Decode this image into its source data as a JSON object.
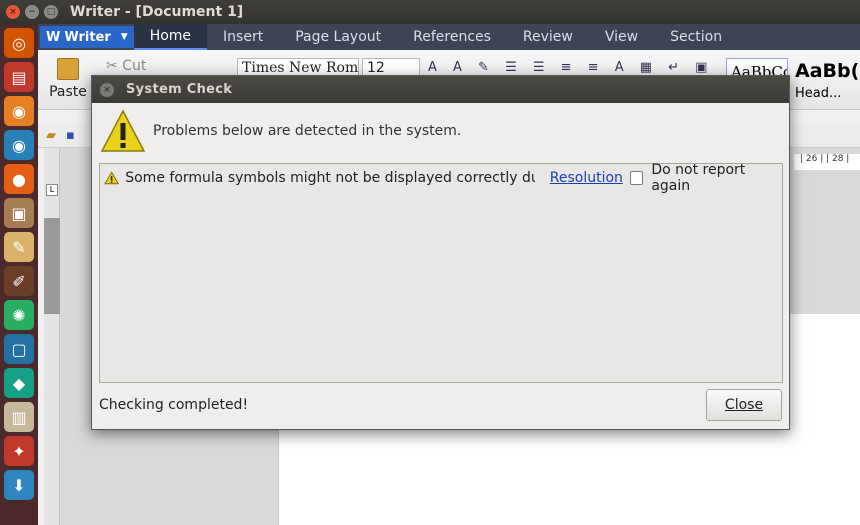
{
  "window": {
    "title": "Writer - [Document 1]",
    "close_glyph": "×",
    "min_glyph": "−",
    "max_glyph": "□"
  },
  "menubar": {
    "app_button": "Writer",
    "tabs": [
      {
        "label": "Home",
        "active": true
      },
      {
        "label": "Insert"
      },
      {
        "label": "Page Layout"
      },
      {
        "label": "References"
      },
      {
        "label": "Review"
      },
      {
        "label": "View"
      },
      {
        "label": "Section"
      }
    ]
  },
  "ribbon": {
    "paste_label": "Paste",
    "cut_label": "Cut",
    "font_name": "Times New Rom",
    "font_size": "12",
    "style_preview_1": "AaBbCcI",
    "style_preview_2": "AaBb(",
    "style_2_name": "Head..."
  },
  "ruler": {
    "marks": "| 26 |  | 28 |"
  },
  "dialog": {
    "title": "System Check",
    "header_message": "Problems below are detected in the system.",
    "problems": [
      {
        "text": "Some formula symbols might not be displayed correctly due to ...",
        "resolution_label": "Resolution",
        "checkbox_label": "Do not report again",
        "checked": false
      }
    ],
    "status": "Checking completed!",
    "close_button": "Close"
  },
  "colors": {
    "accent_blue": "#2a66c8",
    "link": "#1a3fb5",
    "menubar": "#3d4555"
  }
}
